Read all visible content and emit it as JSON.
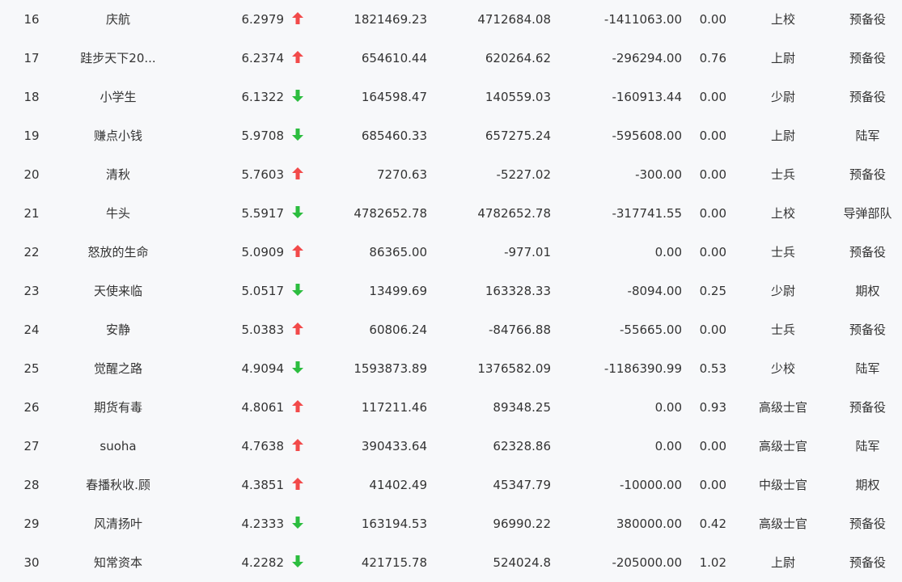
{
  "colors": {
    "up": "#f24a4a",
    "down": "#2cbd3f",
    "text": "#333333",
    "background": "#f7f8fa"
  },
  "rows": [
    {
      "rank": "16",
      "name": "庆航",
      "score": "6.2979",
      "trend": "up",
      "v1": "1821469.23",
      "v2": "4712684.08",
      "v3": "-1411063.00",
      "v4": "0.00",
      "level": "上校",
      "branch": "预备役"
    },
    {
      "rank": "17",
      "name": "跬步天下20...",
      "score": "6.2374",
      "trend": "up",
      "v1": "654610.44",
      "v2": "620264.62",
      "v3": "-296294.00",
      "v4": "0.76",
      "level": "上尉",
      "branch": "预备役"
    },
    {
      "rank": "18",
      "name": "小学生",
      "score": "6.1322",
      "trend": "down",
      "v1": "164598.47",
      "v2": "140559.03",
      "v3": "-160913.44",
      "v4": "0.00",
      "level": "少尉",
      "branch": "预备役"
    },
    {
      "rank": "19",
      "name": "赚点小钱",
      "score": "5.9708",
      "trend": "down",
      "v1": "685460.33",
      "v2": "657275.24",
      "v3": "-595608.00",
      "v4": "0.00",
      "level": "上尉",
      "branch": "陆军"
    },
    {
      "rank": "20",
      "name": "清秋",
      "score": "5.7603",
      "trend": "up",
      "v1": "7270.63",
      "v2": "-5227.02",
      "v3": "-300.00",
      "v4": "0.00",
      "level": "士兵",
      "branch": "预备役"
    },
    {
      "rank": "21",
      "name": "牛头",
      "score": "5.5917",
      "trend": "down",
      "v1": "4782652.78",
      "v2": "4782652.78",
      "v3": "-317741.55",
      "v4": "0.00",
      "level": "上校",
      "branch": "导弹部队"
    },
    {
      "rank": "22",
      "name": "怒放的生命",
      "score": "5.0909",
      "trend": "up",
      "v1": "86365.00",
      "v2": "-977.01",
      "v3": "0.00",
      "v4": "0.00",
      "level": "士兵",
      "branch": "预备役"
    },
    {
      "rank": "23",
      "name": "天使来临",
      "score": "5.0517",
      "trend": "down",
      "v1": "13499.69",
      "v2": "163328.33",
      "v3": "-8094.00",
      "v4": "0.25",
      "level": "少尉",
      "branch": "期权"
    },
    {
      "rank": "24",
      "name": "安静",
      "score": "5.0383",
      "trend": "up",
      "v1": "60806.24",
      "v2": "-84766.88",
      "v3": "-55665.00",
      "v4": "0.00",
      "level": "士兵",
      "branch": "预备役"
    },
    {
      "rank": "25",
      "name": "觉醒之路",
      "score": "4.9094",
      "trend": "down",
      "v1": "1593873.89",
      "v2": "1376582.09",
      "v3": "-1186390.99",
      "v4": "0.53",
      "level": "少校",
      "branch": "陆军"
    },
    {
      "rank": "26",
      "name": "期货有毒",
      "score": "4.8061",
      "trend": "up",
      "v1": "117211.46",
      "v2": "89348.25",
      "v3": "0.00",
      "v4": "0.93",
      "level": "高级士官",
      "branch": "预备役"
    },
    {
      "rank": "27",
      "name": "suoha",
      "score": "4.7638",
      "trend": "up",
      "v1": "390433.64",
      "v2": "62328.86",
      "v3": "0.00",
      "v4": "0.00",
      "level": "高级士官",
      "branch": "陆军"
    },
    {
      "rank": "28",
      "name": "春播秋收.顾",
      "score": "4.3851",
      "trend": "up",
      "v1": "41402.49",
      "v2": "45347.79",
      "v3": "-10000.00",
      "v4": "0.00",
      "level": "中级士官",
      "branch": "期权"
    },
    {
      "rank": "29",
      "name": "风清扬叶",
      "score": "4.2333",
      "trend": "down",
      "v1": "163194.53",
      "v2": "96990.22",
      "v3": "380000.00",
      "v4": "0.42",
      "level": "高级士官",
      "branch": "预备役"
    },
    {
      "rank": "30",
      "name": "知常资本",
      "score": "4.2282",
      "trend": "down",
      "v1": "421715.78",
      "v2": "524024.8",
      "v3": "-205000.00",
      "v4": "1.02",
      "level": "上尉",
      "branch": "预备役"
    }
  ]
}
